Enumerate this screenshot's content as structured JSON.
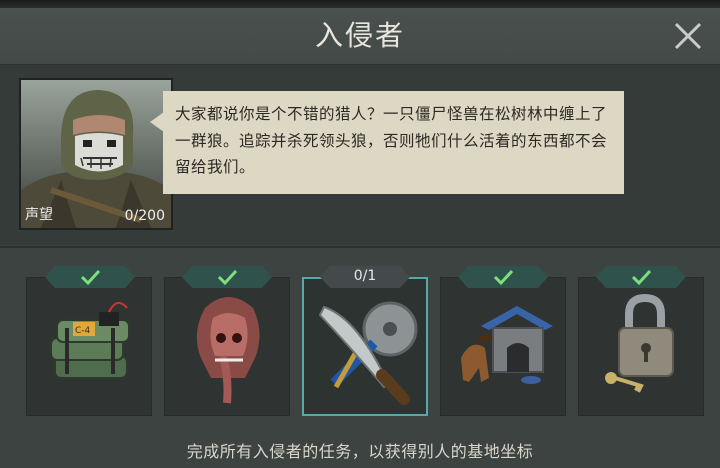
{
  "dialog": {
    "title": "入侵者"
  },
  "quest_giver": {
    "reputation_label": "声望",
    "reputation_value": "0/200",
    "reputation_progress": 0,
    "message": "大家都说你是个不错的猎人？一只僵尸怪兽在松树林中缠上了一群狼。追踪并杀死领头狼，否则牠们什么活着的东西都不会留给我们。"
  },
  "tasks": [
    {
      "icon": "c4-bomb-icon",
      "status": "completed"
    },
    {
      "icon": "zombie-head-icon",
      "status": "completed"
    },
    {
      "icon": "machete-sawblade-icon",
      "status": "active",
      "progress": "0/1"
    },
    {
      "icon": "dog-kennel-icon",
      "status": "completed"
    },
    {
      "icon": "padlock-key-icon",
      "status": "completed"
    }
  ],
  "footer": {
    "hint": "完成所有入侵者的任务，以获得别人的基地坐标"
  },
  "colors": {
    "check": "#7ee07a",
    "tag_bg": "#2f524d",
    "active_border": "#5aa7a9",
    "bubble": "#ddd8c3"
  }
}
